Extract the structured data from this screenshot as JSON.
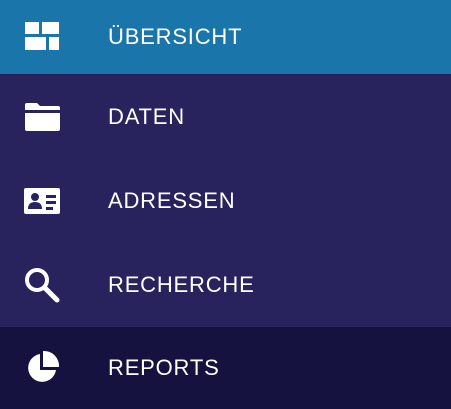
{
  "colors": {
    "active_bg": "#1a75ab",
    "item_bg": "#28235c",
    "footer_item_bg": "#16123f",
    "text": "#ffffff"
  },
  "nav": {
    "items": [
      {
        "label": "ÜBERSICHT",
        "icon": "dashboard-icon",
        "active": true
      },
      {
        "label": "DATEN",
        "icon": "folder-icon",
        "active": false
      },
      {
        "label": "ADRESSEN",
        "icon": "contact-card-icon",
        "active": false
      },
      {
        "label": "RECHERCHE",
        "icon": "search-icon",
        "active": false
      },
      {
        "label": "REPORTS",
        "icon": "pie-chart-icon",
        "active": false
      }
    ]
  }
}
